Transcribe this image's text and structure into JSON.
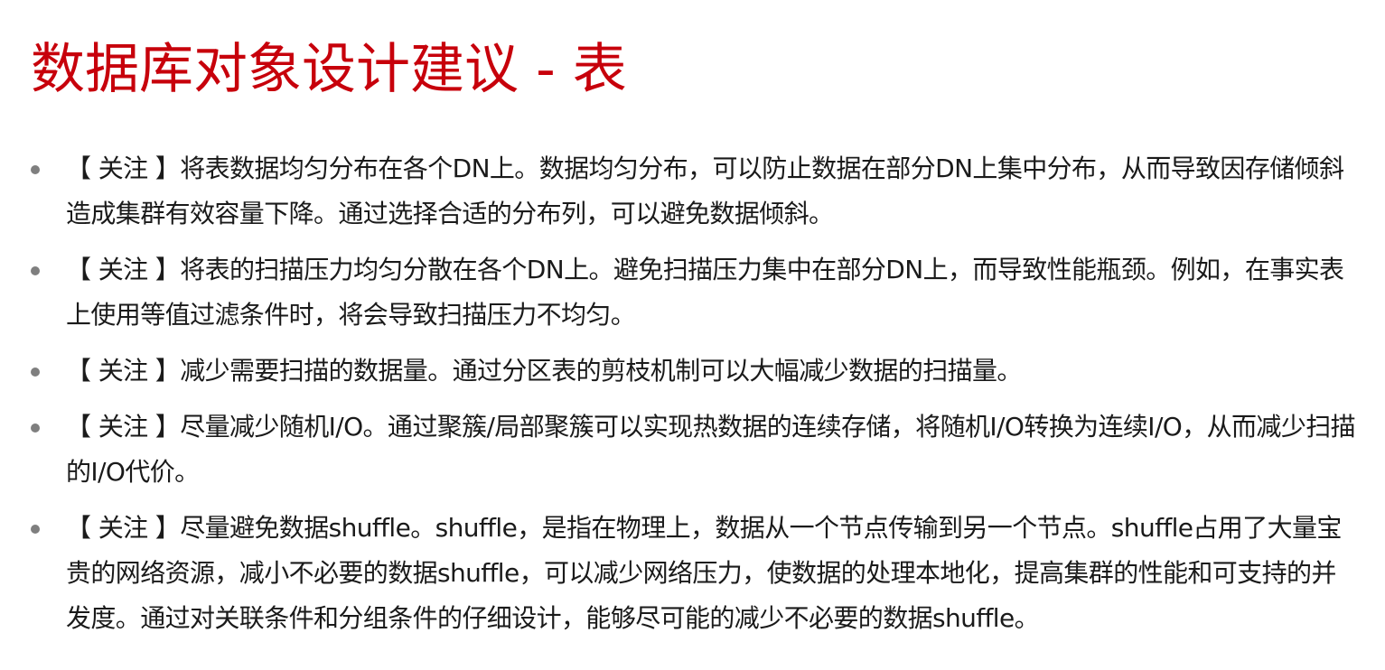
{
  "slide": {
    "title": "数据库对象设计建议 - 表",
    "bullets": [
      {
        "text": "【 关注 】将表数据均匀分布在各个DN上。数据均匀分布，可以防止数据在部分DN上集中分布，从而导致因存储倾斜造成集群有效容量下降。通过选择合适的分布列，可以避免数据倾斜。"
      },
      {
        "text": "【 关注 】将表的扫描压力均匀分散在各个DN上。避免扫描压力集中在部分DN上，而导致性能瓶颈。例如，在事实表上使用等值过滤条件时，将会导致扫描压力不均匀。"
      },
      {
        "text": "【 关注 】减少需要扫描的数据量。通过分区表的剪枝机制可以大幅减少数据的扫描量。"
      },
      {
        "text": "【 关注 】尽量减少随机I/O。通过聚簇/局部聚簇可以实现热数据的连续存储，将随机I/O转换为连续I/O，从而减少扫描的I/O代价。"
      },
      {
        "text": "【 关注 】尽量避免数据shuffle。shuffle，是指在物理上，数据从一个节点传输到另一个节点。shuffle占用了大量宝贵的网络资源，减小不必要的数据shuffle，可以减少网络压力，使数据的处理本地化，提高集群的性能和可支持的并发度。通过对关联条件和分组条件的仔细设计，能够尽可能的减少不必要的数据shuffle。"
      }
    ]
  },
  "colors": {
    "title": "#c7000b",
    "text": "#1a1a1a",
    "bullet": "#7f7f7f",
    "background": "#ffffff"
  }
}
